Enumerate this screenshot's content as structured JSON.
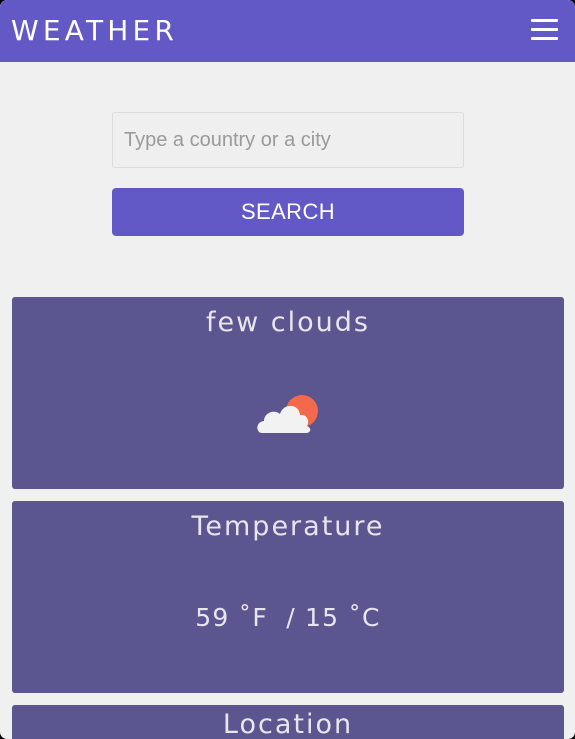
{
  "header": {
    "title": "WEATHER",
    "menu_icon": "hamburger-menu-icon"
  },
  "search": {
    "placeholder": "Type a country or a city",
    "value": "",
    "button_label": "SEARCH"
  },
  "cards": {
    "condition": {
      "label": "few clouds",
      "icon": "partly-cloudy-icon"
    },
    "temperature": {
      "label": "Temperature",
      "value": "59 ˚F  / 15 ˚C"
    },
    "location": {
      "label": "Location"
    }
  },
  "colors": {
    "accent": "#6259c6",
    "card_background": "#5b5590",
    "page_background": "#f0f0f0",
    "sun": "#f26a4b",
    "cloud": "#f2f2f2"
  }
}
